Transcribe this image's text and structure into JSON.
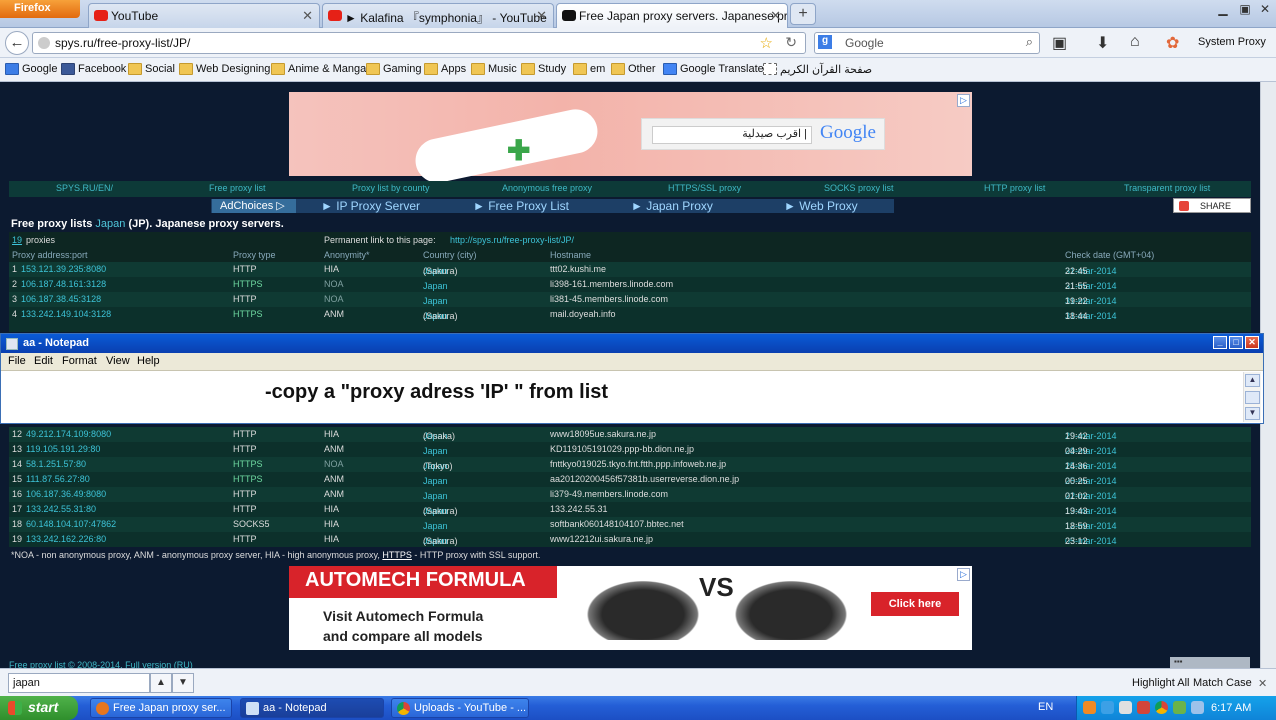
{
  "browser": {
    "app_button": "Firefox",
    "tabs": [
      {
        "title": "YouTube",
        "active": false
      },
      {
        "title": "► Kalafina 『symphonia』 - YouTube",
        "active": false
      },
      {
        "title": "Free Japan proxy servers. Japanese pro...",
        "active": true
      }
    ],
    "new_tab": "+",
    "url": "spys.ru/free-proxy-list/JP/",
    "search_placeholder": "Google",
    "system_proxy": "System Proxy",
    "bookmarks": [
      "Google",
      "Facebook",
      "Social",
      "Web Designing",
      "Anime & Manga",
      "Gaming",
      "Apps",
      "Music",
      "Study",
      "em",
      "Other",
      "Google Translate",
      "صفحة القرآن الكريم"
    ]
  },
  "page": {
    "ad_top": {
      "search_text": "اقرب صيدلية |",
      "logo": "Google"
    },
    "menu": [
      "SPYS.RU/EN/",
      "Free proxy list",
      "Proxy list by county",
      "Anonymous free proxy",
      "HTTPS/SSL proxy",
      "SOCKS proxy list",
      "HTTP proxy list",
      "Transparent proxy list"
    ],
    "menu2": {
      "adchoices": "AdChoices ▷",
      "items": [
        "► IP Proxy Server",
        "► Free Proxy List",
        "► Japan Proxy",
        "► Web Proxy"
      ]
    },
    "share": "SHARE",
    "title_prefix": "Free proxy lists",
    "title_country": "Japan",
    "title_rest": "(JP). Japanese proxy servers.",
    "count_num": "19",
    "count_label": "proxies",
    "perm_label": "Permanent link to this page:",
    "perm_link": "http://spys.ru/free-proxy-list/JP/",
    "headers": [
      "Proxy address:port",
      "Proxy type",
      "Anonymity*",
      "Country (city)",
      "Hostname",
      "Check date (GMT+04)"
    ],
    "rows_top": [
      {
        "n": "1",
        "ip": "153.121.39.235:8080",
        "type": "HTTP",
        "anon": "HIA",
        "country": "Japan",
        "city": "(Sakura)",
        "host": "ttt02.kushi.me",
        "date": "31-mar-2014",
        "time": "22:45"
      },
      {
        "n": "2",
        "ip": "106.187.48.161:3128",
        "type": "HTTPS",
        "anon": "NOA",
        "country": "Japan",
        "city": "",
        "host": "li398-161.members.linode.com",
        "date": "31-mar-2014",
        "time": "21:55"
      },
      {
        "n": "3",
        "ip": "106.187.38.45:3128",
        "type": "HTTP",
        "anon": "NOA",
        "country": "Japan",
        "city": "",
        "host": "li381-45.members.linode.com",
        "date": "31-mar-2014",
        "time": "19:22"
      },
      {
        "n": "4",
        "ip": "133.242.149.104:3128",
        "type": "HTTPS",
        "anon": "ANM",
        "country": "Japan",
        "city": "(Sakura)",
        "host": "mail.doyeah.info",
        "date": "31-mar-2014",
        "time": "18:44"
      }
    ],
    "rows_bottom": [
      {
        "n": "12",
        "ip": "49.212.174.109:8080",
        "type": "HTTP",
        "anon": "HIA",
        "country": "Japan",
        "city": "(Osaka)",
        "host": "www18095ue.sakura.ne.jp",
        "date": "29-mar-2014",
        "time": "19:42"
      },
      {
        "n": "13",
        "ip": "119.105.191.29:80",
        "type": "HTTP",
        "anon": "ANM",
        "country": "Japan",
        "city": "",
        "host": "KD119105191029.ppp-bb.dion.ne.jp",
        "date": "29-mar-2014",
        "time": "04:29"
      },
      {
        "n": "14",
        "ip": "58.1.251.57:80",
        "type": "HTTPS",
        "anon": "NOA",
        "country": "Japan",
        "city": "(Tokyo)",
        "host": "fnttkyo019025.tkyo.fnt.ftth.ppp.infoweb.ne.jp",
        "date": "25-mar-2014",
        "time": "14:36"
      },
      {
        "n": "15",
        "ip": "111.87.56.27:80",
        "type": "HTTPS",
        "anon": "ANM",
        "country": "Japan",
        "city": "",
        "host": "aa20120200456f57381b.userreverse.dion.ne.jp",
        "date": "25-mar-2014",
        "time": "00:25"
      },
      {
        "n": "16",
        "ip": "106.187.36.49:8080",
        "type": "HTTP",
        "anon": "ANM",
        "country": "Japan",
        "city": "",
        "host": "li379-49.members.linode.com",
        "date": "22-mar-2014",
        "time": "01:02"
      },
      {
        "n": "17",
        "ip": "133.242.55.31:80",
        "type": "HTTP",
        "anon": "HIA",
        "country": "Japan",
        "city": "(Sakura)",
        "host": "133.242.55.31",
        "date": "13-mar-2014",
        "time": "19:43"
      },
      {
        "n": "18",
        "ip": "60.148.104.107:47862",
        "type": "SOCKS5",
        "anon": "HIA",
        "country": "Japan",
        "city": "",
        "host": "softbank060148104107.bbtec.net",
        "date": "12-mar-2014",
        "time": "18:59"
      },
      {
        "n": "19",
        "ip": "133.242.162.226:80",
        "type": "HTTP",
        "anon": "HIA",
        "country": "Japan",
        "city": "(Sakura)",
        "host": "www12212ui.sakura.ne.jp",
        "date": "05-mar-2014",
        "time": "23:12"
      }
    ],
    "footnote_a": "*NOA - non anonymous proxy, ANM - anonymous proxy server, HIA - high anonymous proxy,",
    "footnote_https": "HTTPS",
    "footnote_b": "- HTTP proxy with SSL support.",
    "ad_bottom": {
      "brand": "AUTOMECH FORMULA",
      "line1": "Visit Automech Formula",
      "line2": "and compare all models",
      "vs": "VS",
      "cta": "Click here"
    },
    "copyright": "Free proxy list © 2008-2014. Full version (RU)"
  },
  "notepad": {
    "title": "aa - Notepad",
    "menu": [
      "File",
      "Edit",
      "Format",
      "View",
      "Help"
    ],
    "text": "-copy a \"proxy adress 'IP' \" from list"
  },
  "findbar": {
    "query": "japan",
    "highlight": "Highlight All",
    "match_case": "Match Case"
  },
  "taskbar": {
    "start": "start",
    "tasks": [
      "Free Japan proxy ser...",
      "aa - Notepad",
      "Uploads - YouTube - ..."
    ],
    "lang": "EN",
    "clock": "6:17 AM"
  }
}
